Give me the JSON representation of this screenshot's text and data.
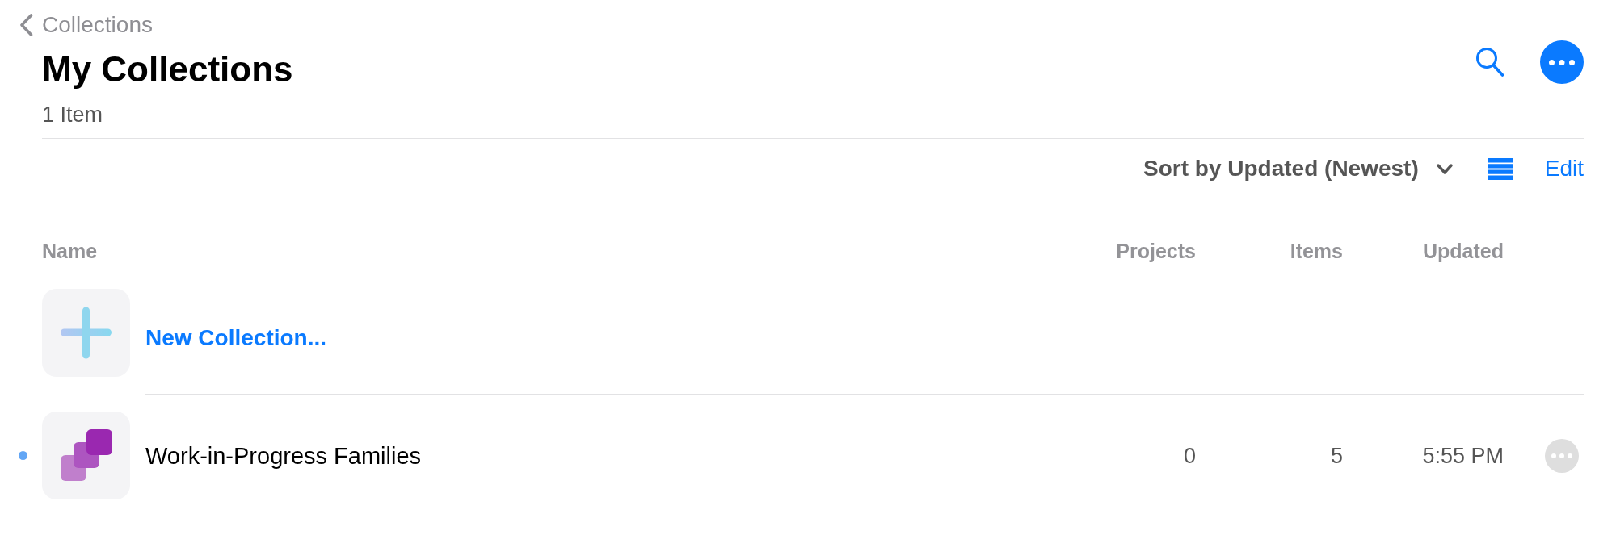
{
  "navigation": {
    "back_label": "Collections"
  },
  "header": {
    "title": "My Collections",
    "subtitle": "1 Item"
  },
  "toolbar": {
    "sort_label": "Sort by Updated (Newest)",
    "edit_label": "Edit"
  },
  "table": {
    "columns": [
      "Name",
      "Projects",
      "Items",
      "Updated"
    ],
    "rows": [
      {
        "kind": "new",
        "name": "New Collection..."
      },
      {
        "kind": "collection",
        "name": "Work-in-Progress Families",
        "projects": "0",
        "items": "5",
        "updated": "5:55 PM",
        "unread": true
      }
    ]
  }
}
